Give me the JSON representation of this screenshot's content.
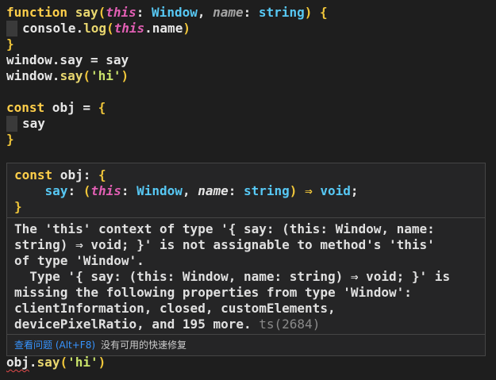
{
  "code": {
    "l1": {
      "kw_function": "function",
      "name_say": "say",
      "paren_open": "(",
      "kw_this": "this",
      "colon1": ": ",
      "type_window": "Window",
      "comma": ", ",
      "param_name": "name",
      "colon2": ": ",
      "type_string": "string",
      "paren_close": ")",
      "brace_open": " {"
    },
    "l2": {
      "obj": "console",
      "dot": ".",
      "method": "log",
      "po": "(",
      "this": "this",
      "prop": ".name",
      "pc": ")"
    },
    "l3": {
      "brace": "}"
    },
    "l4": {
      "text": "window.say = say"
    },
    "l5": {
      "obj": "window",
      "dot": ".",
      "method": "say",
      "po": "(",
      "str": "'hi'",
      "pc": ")"
    },
    "l7": {
      "kw": "const",
      "rest": " obj = ",
      "brace": "{"
    },
    "l8": {
      "text": "say"
    },
    "l9": {
      "brace": "}"
    },
    "l10": {
      "obj": "obj",
      "dot": ".",
      "method": "say",
      "po": "(",
      "str": "'hi'",
      "pc": ")"
    }
  },
  "hover": {
    "sig1": {
      "kw": "const",
      "rest": " obj: ",
      "brace": "{"
    },
    "sig2": {
      "prop": "say",
      "colon": ": ",
      "po": "(",
      "this": "this",
      "colon2": ": ",
      "type_window": "Window",
      "comma": ", ",
      "param": "name",
      "colon3": ": ",
      "type_string": "string",
      "pc": ")",
      "arrow": " ⇒ ",
      "void": "void",
      "semi": ";"
    },
    "sig3": {
      "brace": "}"
    },
    "message": [
      "The 'this' context of type '{ say: (this: Window, name:",
      "string) ⇒ void; }' is not assignable to method's 'this'",
      "of type 'Window'.",
      "  Type '{ say: (this: Window, name: string) ⇒ void; }' is",
      "missing the following properties from type 'Window':",
      "clientInformation, closed, customElements,",
      "devicePixelRatio, and 195 more."
    ],
    "ts_code": " ts(2684)",
    "footer": {
      "view_problem": "查看问题 (Alt+F8)",
      "no_quick_fix": "没有可用的快速修复"
    }
  }
}
